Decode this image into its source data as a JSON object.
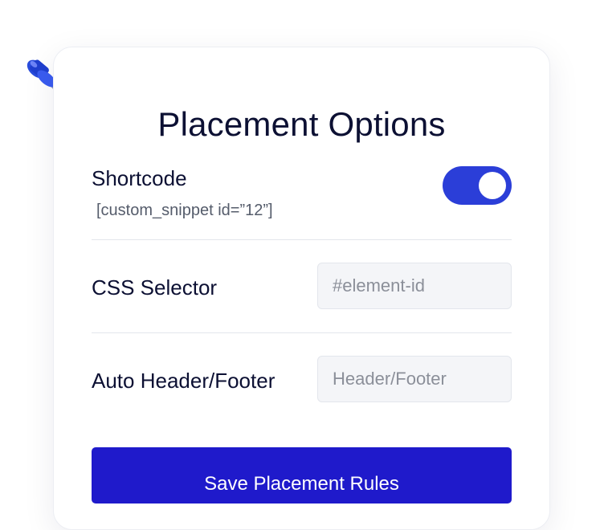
{
  "panel": {
    "title": "Placement Options",
    "shortcode": {
      "label": "Shortcode",
      "value": "[custom_snippet id=”12”]",
      "enabled": true
    },
    "css_selector": {
      "label": "CSS Selector",
      "placeholder": "#element-id"
    },
    "auto_header_footer": {
      "label": "Auto Header/Footer",
      "placeholder": "Header/Footer"
    },
    "save_label": "Save Placement Rules"
  },
  "colors": {
    "accent": "#2b3ed8",
    "button": "#1f1acb",
    "title_text": "#0c1033",
    "pin": "#2346d8",
    "code_icon": "#e53a3a"
  },
  "icons": [
    "pushpin-icon",
    "code-tag-icon"
  ]
}
